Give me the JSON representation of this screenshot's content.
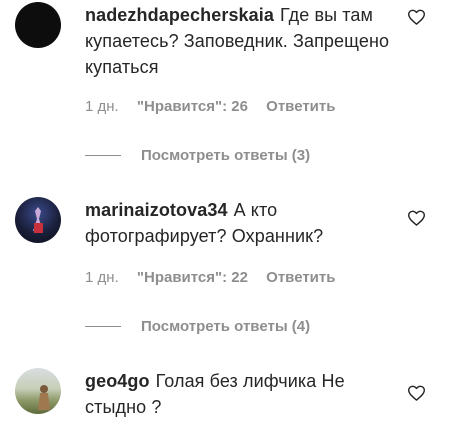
{
  "comments": [
    {
      "username": "nadezhdapecherskaia",
      "text": "Где вы там купаетесь? Заповедник. Запрещено купаться",
      "time": "1 дн.",
      "likes": "\"Нравится\": 26",
      "reply": "Ответить",
      "view_replies": "Посмотреть ответы (3)"
    },
    {
      "username": "marinaizotova34",
      "text": "А кто фотографирует? Охранник?",
      "time": "1 дн.",
      "likes": "\"Нравится\": 22",
      "reply": "Ответить",
      "view_replies": "Посмотреть ответы (4)"
    },
    {
      "username": "geo4go",
      "text": "Голая без лифчика Не стыдно ?"
    }
  ],
  "icons": {
    "like": "heart-outline-icon"
  },
  "colors": {
    "text": "#262626",
    "secondary": "#8e8e8e"
  }
}
